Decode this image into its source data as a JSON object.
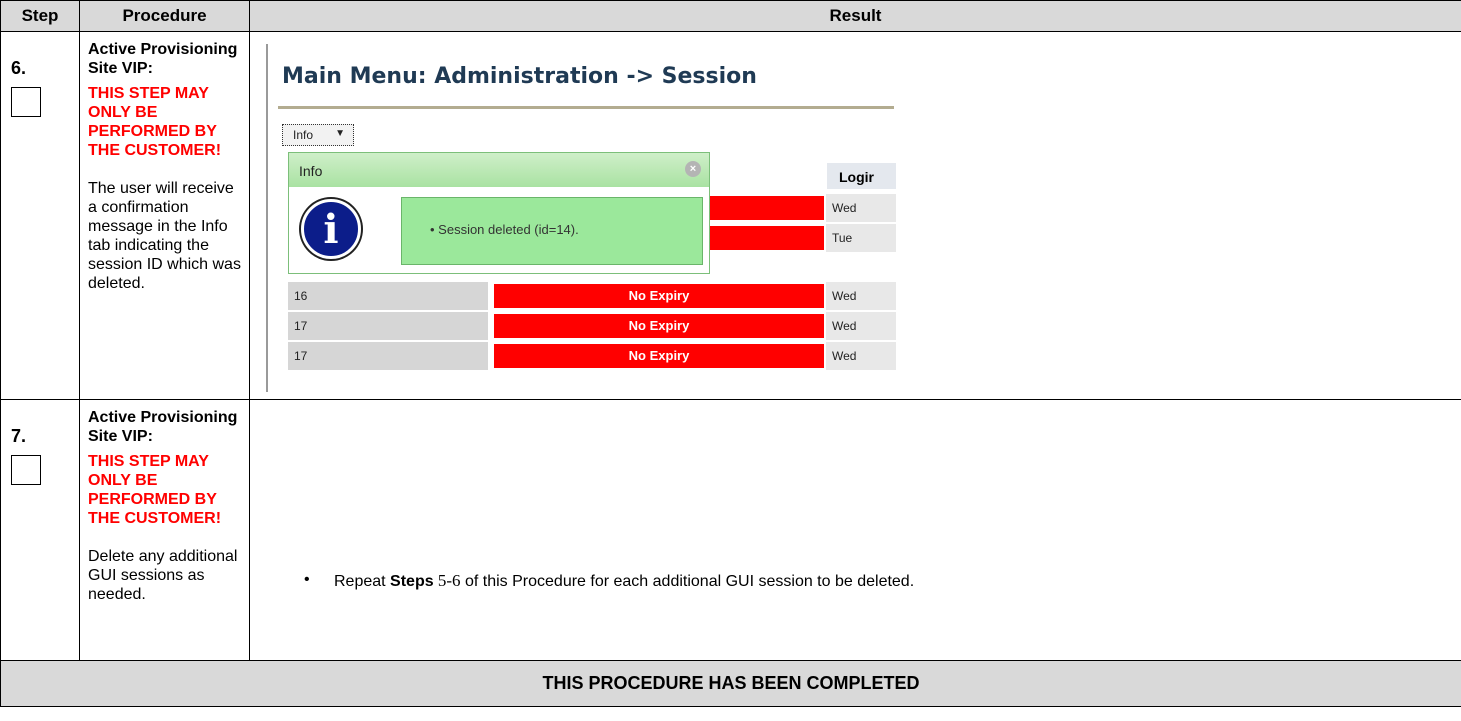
{
  "headers": {
    "step": "Step",
    "procedure": "Procedure",
    "result": "Result"
  },
  "step6": {
    "number": "6.",
    "heading": "Active Provisioning Site VIP:",
    "warning": "THIS STEP MAY ONLY BE PERFORMED BY THE CUSTOMER!",
    "description": "The user will receive a confirmation message in the Info tab indicating the session ID which was deleted.",
    "screenshot": {
      "title": "Main Menu: Administration -> Session",
      "info_dropdown": "Info",
      "popup_title": "Info",
      "message": "• Session deleted (id=14).",
      "login_header": "Logir",
      "rows": [
        {
          "id": "",
          "expiry": "",
          "login": "Wed"
        },
        {
          "id": "",
          "expiry": "",
          "login": "Tue"
        },
        {
          "id": "16",
          "expiry": "No Expiry",
          "login": "Wed"
        },
        {
          "id": "17",
          "expiry": "No Expiry",
          "login": "Wed"
        },
        {
          "id": "17",
          "expiry": "No Expiry",
          "login": "Wed"
        }
      ]
    }
  },
  "step7": {
    "number": "7.",
    "heading": "Active Provisioning Site VIP:",
    "warning": "THIS STEP MAY ONLY BE PERFORMED BY THE CUSTOMER!",
    "description": "Delete any additional GUI sessions as needed.",
    "result": {
      "bullet": "•",
      "pre": "Repeat ",
      "bold": "Steps",
      "range": " 5-6",
      "post": " of this Procedure for each additional GUI session to be deleted."
    }
  },
  "footer": "THIS PROCEDURE HAS BEEN COMPLETED"
}
